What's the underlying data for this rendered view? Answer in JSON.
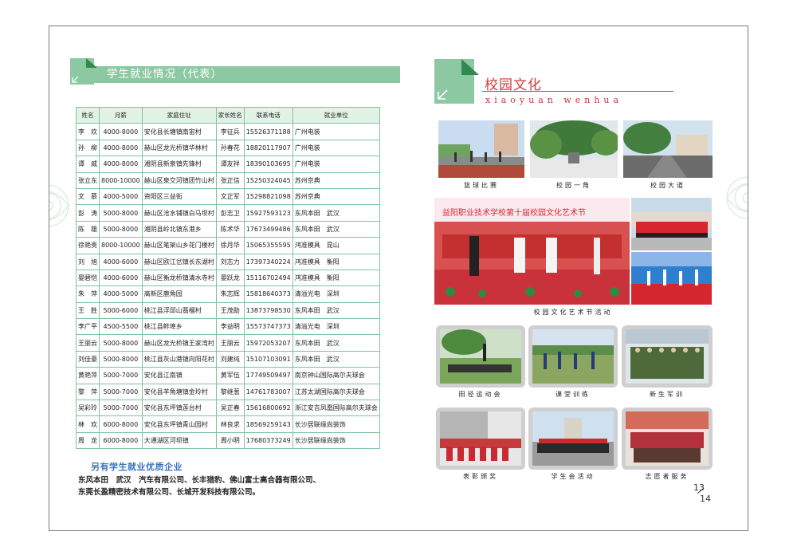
{
  "left": {
    "heading": "学生就业情况（代表）",
    "table": {
      "headers": [
        "姓名",
        "月薪",
        "家庭住址",
        "家长姓名",
        "联系电话",
        "就业单位"
      ],
      "rows": [
        [
          "李　欢",
          "4000-8000",
          "安化县长塘镇南宙村",
          "李征兵",
          "15526371188",
          "广州电装"
        ],
        [
          "孙　柳",
          "4000-8000",
          "赫山区龙光桥镇华林村",
          "孙春花",
          "18820117907",
          "广州电装"
        ],
        [
          "谭　威",
          "4000-8000",
          "湘阴县新泉镇先锋村",
          "谭友祥",
          "18390103695",
          "广州电装"
        ],
        [
          "张立东",
          "8000-10000",
          "赫山区泉交河镇团竹山村",
          "张正信",
          "15250324045",
          "苏州京典"
        ],
        [
          "文　慕",
          "4000-5000",
          "资阳区三益街",
          "文正军",
          "15298821098",
          "苏州京典"
        ],
        [
          "彭　涛",
          "5000-8000",
          "赫山区沧水铺镇白马坝村",
          "彭志卫",
          "15927593123",
          "东风本田　武汉"
        ],
        [
          "陈　雄",
          "5000-8000",
          "湘阴县岭北镇东港乡",
          "陈术华",
          "17673499486",
          "东风本田　武汉"
        ],
        [
          "徐艳贵",
          "8000-10000",
          "赫山区笔架山乡花门楼村",
          "徐月华",
          "15065355595",
          "鸿准模具　昆山"
        ],
        [
          "刘　旭",
          "4000-6000",
          "赫山区欧江岔镇长东湖村",
          "刘志力",
          "17397340224",
          "鸿准模具　衡阳"
        ],
        [
          "晏碧恺",
          "4000-6000",
          "赫山区衡龙桥镇清水寺村",
          "晏跃龙",
          "15116702494",
          "鸿准模具　衡阳"
        ],
        [
          "朱　萍",
          "4000-5000",
          "高新区鹿角园",
          "朱志辉",
          "15818640373",
          "清溢光电　深圳"
        ],
        [
          "王　胜",
          "5000-6000",
          "桃江县浮邱山翡榴村",
          "王茂助",
          "13873798530",
          "东风本田　武汉"
        ],
        [
          "李广平",
          "4500-5500",
          "桃江县鲊埠乡",
          "李益明",
          "15573747373",
          "清溢光电　深圳"
        ],
        [
          "王丽云",
          "5000-8000",
          "赫山区龙光桥镇王家湾村",
          "王丽云",
          "15972053207",
          "东风本田　武汉"
        ],
        [
          "刘佳豪",
          "5000-8000",
          "桃江县灰山港镇向阳花村",
          "刘建纯",
          "15107103091",
          "东风本田　武汉"
        ],
        [
          "黄艳萍",
          "5000-7000",
          "安化县江南镇",
          "黄军伍",
          "17749509497",
          "南京钟山国际高尔夫球会"
        ],
        [
          "黎　萍",
          "5000-7000",
          "安化县羊角塘镇金玲村",
          "黎继葱",
          "14761783007",
          "江苏太湖国际高尔夫球会"
        ],
        [
          "吴彩玲",
          "5000-7000",
          "安化县东坪镇莲台村",
          "吴正春",
          "15616800692",
          "浙江安吉凤凰国际高尔夫球会"
        ],
        [
          "林　欢",
          "6000-8000",
          "安化县东坪镇青山园村",
          "林良求",
          "18569259143",
          "长沙居联缘尚装饰"
        ],
        [
          "周　龙",
          "6000-8000",
          "大通湖区河坝镇",
          "周小明",
          "17680373249",
          "长沙居联缘尚装饰"
        ]
      ]
    },
    "more_title": "另有学生就业优质企业",
    "more_line1": "东风本田　武汉　汽车有限公司、长丰猎豹、佛山富士高合器有限公司、",
    "more_line2": "东莞长盈精密技术有限公司、长城开发科技有限公司。"
  },
  "right": {
    "heading": "校园文化",
    "pinyin": "xiaoyuan wenhua",
    "banner_text": "益阳职业技术学校第十届校园文化艺术节",
    "captions": {
      "basketball": "篮球比赛",
      "corner": "校园一角",
      "avenue": "校园大道",
      "festival": "校园文化艺术节活动",
      "sports": "田径运动会",
      "training": "课堂训练",
      "military": "新生军训",
      "award": "表彰颁奖",
      "union": "学生会活动",
      "volunteer": "志愿者服务"
    },
    "page_a": "13",
    "page_b": "14"
  },
  "colors": {
    "accent_green": "#8cc9a2",
    "table_border": "#7fc39c",
    "title_red": "#d63a3a",
    "subtitle_blue": "#3b73c0"
  }
}
